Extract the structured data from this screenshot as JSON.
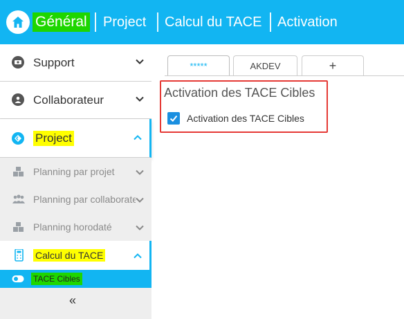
{
  "header": {
    "home_icon": "home-icon",
    "nav": [
      "Général",
      "Project",
      "Calcul du TACE",
      "Activation"
    ],
    "brand_color": "#12b5f2",
    "highlight_green": "#1ed600"
  },
  "sidebar": {
    "items": [
      {
        "label": "Support",
        "icon": "support-icon"
      },
      {
        "label": "Collaborateur",
        "icon": "user-icon"
      },
      {
        "label": "Project",
        "icon": "project-icon"
      }
    ],
    "sub_items": [
      {
        "label": "Planning par projet",
        "icon": "boxes-icon"
      },
      {
        "label": "Planning par collaborateur",
        "icon": "people-icon"
      },
      {
        "label": "Planning horodaté",
        "icon": "boxes-icon"
      },
      {
        "label": "Calcul du TACE",
        "icon": "calculator-icon"
      }
    ],
    "active_leaf": {
      "label": "TACE Cibles",
      "icon": "toggle-icon"
    },
    "collapse_label": "«"
  },
  "main": {
    "tabs": [
      {
        "label": "*****"
      },
      {
        "label": "AKDEV"
      },
      {
        "label": "+"
      }
    ],
    "section_title": "Activation des TACE Cibles",
    "checkbox": {
      "label": "Activation des TACE Cibles",
      "checked": true
    }
  }
}
